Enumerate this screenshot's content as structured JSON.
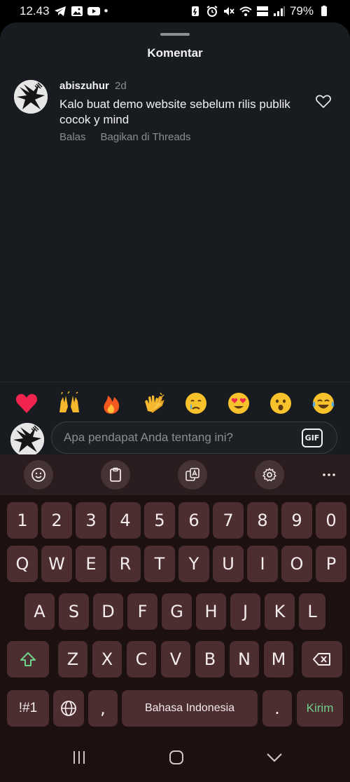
{
  "status_bar": {
    "time": "12.43",
    "battery": "79%",
    "dot": "•"
  },
  "sheet": {
    "title": "Komentar",
    "comment": {
      "username": "abiszuhur",
      "time": "2d",
      "text": "Kalo buat demo website sebelum rilis publik cocok y mind",
      "reply_label": "Balas",
      "share_label": "Bagikan di Threads"
    }
  },
  "emoji_bar": {
    "emojis": [
      "heart",
      "raising-hands",
      "fire",
      "clapping-hands",
      "crying-face",
      "heart-eyes",
      "surprised-face",
      "tears-of-joy"
    ]
  },
  "input": {
    "placeholder": "Apa pendapat Anda tentang ini?",
    "gif_label": "GIF"
  },
  "keyboard": {
    "toolbar": [
      "emoji-icon",
      "clipboard-icon",
      "translate-icon",
      "gear-icon",
      "more-icon"
    ],
    "row_numbers": [
      "1",
      "2",
      "3",
      "4",
      "5",
      "6",
      "7",
      "8",
      "9",
      "0"
    ],
    "row_1": [
      "Q",
      "W",
      "E",
      "R",
      "T",
      "Y",
      "U",
      "I",
      "O",
      "P"
    ],
    "row_2": [
      "A",
      "S",
      "D",
      "F",
      "G",
      "H",
      "J",
      "K",
      "L"
    ],
    "row_3": [
      "Z",
      "X",
      "C",
      "V",
      "B",
      "N",
      "M"
    ],
    "symbols_label": "!#1",
    "comma": ",",
    "space_label": "Bahasa Indonesia",
    "period": ".",
    "send_label": "Kirim",
    "accent_color": "#6fd08a",
    "key_color": "#4c2d30"
  },
  "nav_bar": {
    "buttons": [
      "recents-icon",
      "home-icon",
      "back-icon"
    ]
  }
}
